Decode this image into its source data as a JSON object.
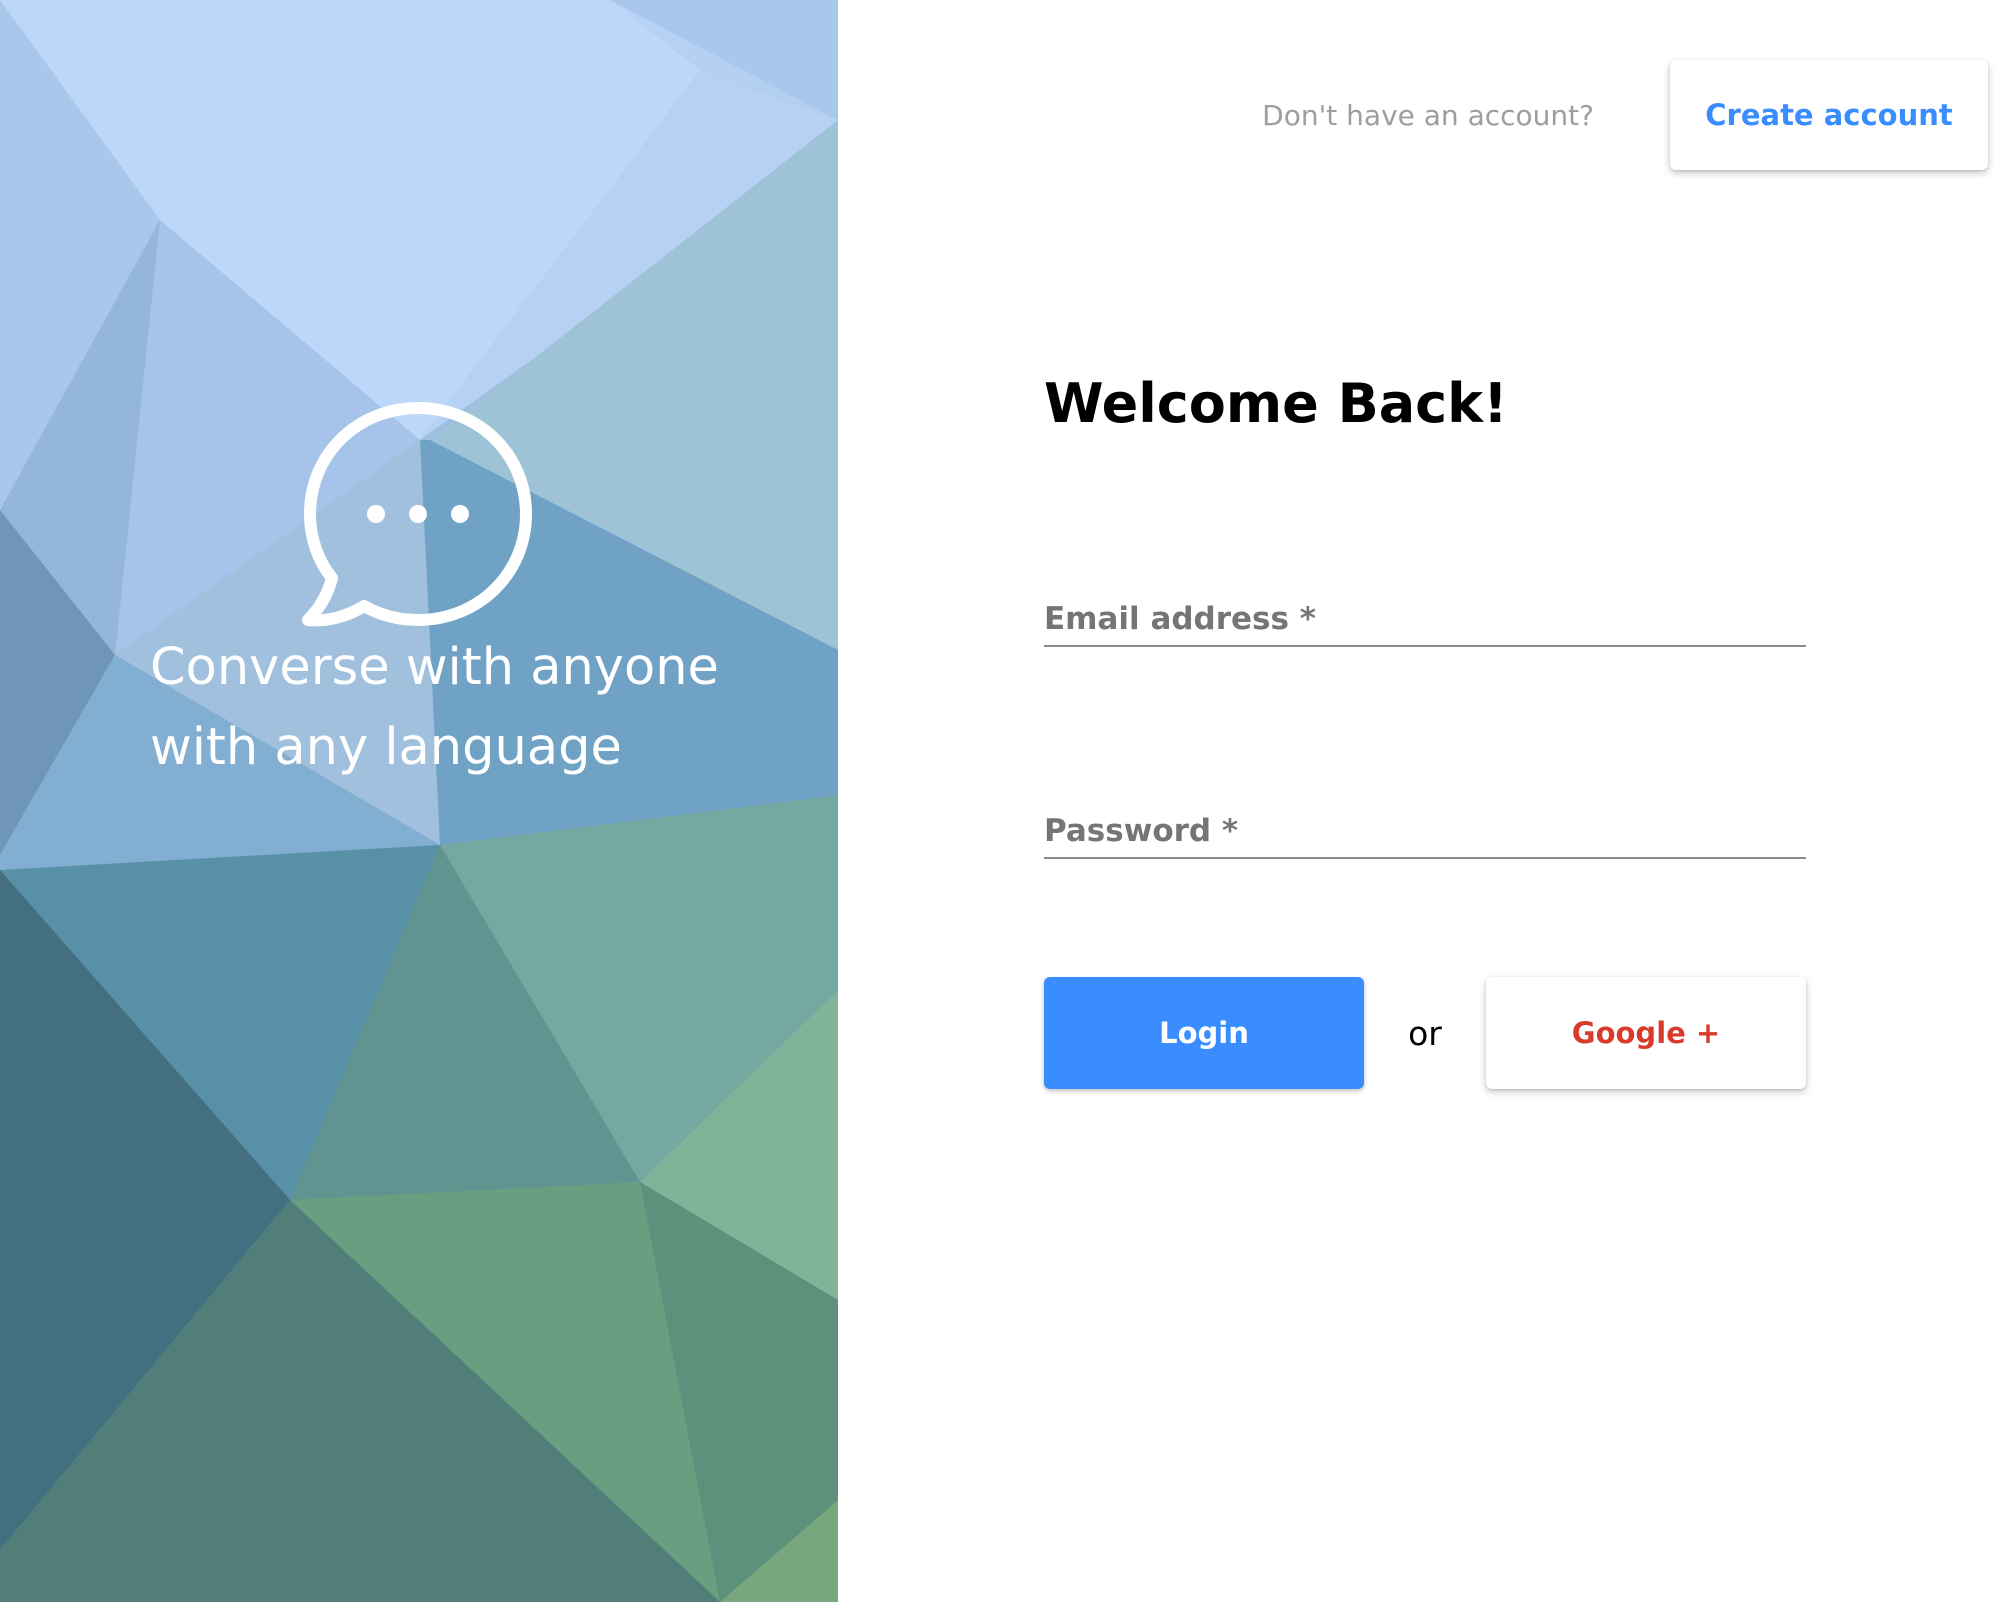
{
  "hero": {
    "tagline_line1": "Converse with anyone",
    "tagline_line2": "with any language",
    "icon": "chat-bubble-icon"
  },
  "header": {
    "prompt": "Don't have an account?",
    "create_account_label": "Create account"
  },
  "form": {
    "title": "Welcome Back!",
    "email_label": "Email address *",
    "email_value": "",
    "password_label": "Password *",
    "password_value": "",
    "login_label": "Login",
    "or_label": "or",
    "google_label": "Google +"
  },
  "colors": {
    "primary": "#3a8dff",
    "google": "#d93a2b",
    "muted": "#9e9e9e",
    "label": "#757575"
  }
}
